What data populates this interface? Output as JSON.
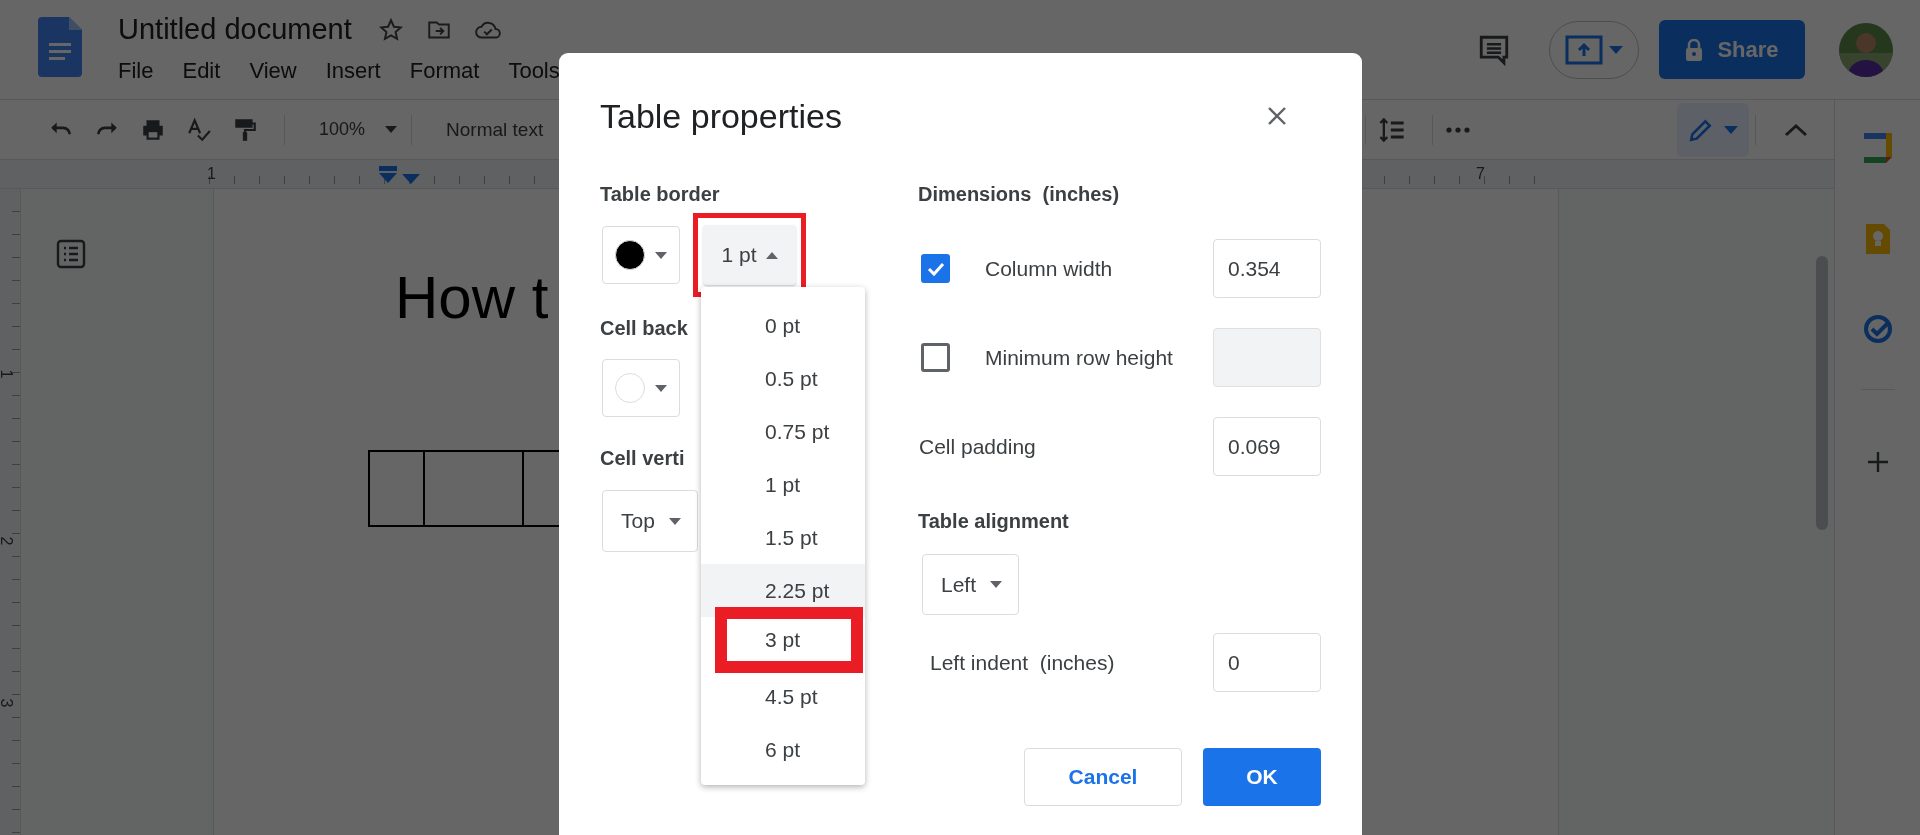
{
  "document": {
    "title": "Untitled document",
    "menu": [
      "File",
      "Edit",
      "View",
      "Insert",
      "Format",
      "Tools"
    ],
    "heading": "How t"
  },
  "toolbar": {
    "zoom": "100%",
    "style": "Normal text"
  },
  "ruler": {
    "labels": [
      "1",
      "7"
    ]
  },
  "vertical_ruler": {
    "labels": [
      "1",
      "2",
      "3"
    ]
  },
  "share_button": {
    "label": "Share"
  },
  "dialog": {
    "title": "Table properties",
    "table_border": {
      "label": "Table border",
      "color": "#000000",
      "weight": "1 pt",
      "menu_open": true,
      "marked": true
    },
    "weight_options": [
      {
        "label": "0 pt",
        "hovered": false,
        "marked": false
      },
      {
        "label": "0.5 pt",
        "hovered": false,
        "marked": false
      },
      {
        "label": "0.75 pt",
        "hovered": false,
        "marked": false
      },
      {
        "label": "1 pt",
        "hovered": false,
        "marked": false
      },
      {
        "label": "1.5 pt",
        "hovered": false,
        "marked": false
      },
      {
        "label": "2.25 pt",
        "hovered": true,
        "marked": false
      },
      {
        "label": "3 pt",
        "hovered": false,
        "marked": true
      },
      {
        "label": "4.5 pt",
        "hovered": false,
        "marked": false
      },
      {
        "label": "6 pt",
        "hovered": false,
        "marked": false
      }
    ],
    "cell_background": {
      "label": "Cell back",
      "color": "#ffffff"
    },
    "cell_vertical_alignment": {
      "label": "Cell verti",
      "value": "Top"
    },
    "dimensions": {
      "label": "Dimensions  (inches)",
      "rows": [
        {
          "kind": "checkbox",
          "label": "Column width",
          "checked": true,
          "disabled": false,
          "value": "0.354"
        },
        {
          "kind": "checkbox",
          "label": "Minimum row height",
          "checked": false,
          "disabled": true
        },
        {
          "kind": "plain",
          "label": "Cell padding",
          "disabled": false,
          "value": "0.069"
        }
      ]
    },
    "table_alignment": {
      "label": "Table alignment",
      "value": "Left"
    },
    "left_indent": {
      "label": "Left indent  (inches)",
      "value": "0"
    },
    "buttons": [
      {
        "label": "Cancel",
        "kind": "secondary"
      },
      {
        "label": "OK",
        "kind": "primary"
      }
    ]
  }
}
